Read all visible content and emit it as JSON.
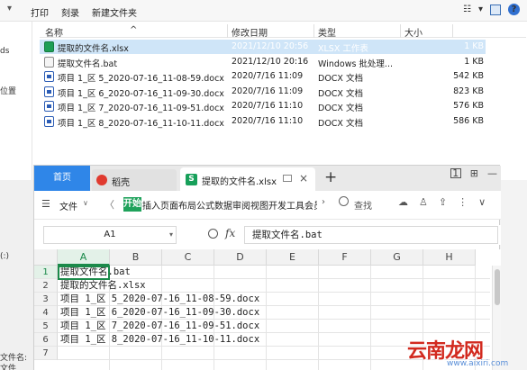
{
  "explorer": {
    "toolbar": {
      "print": "打印",
      "burn": "刻录",
      "new_folder": "新建文件夹"
    },
    "nav_fragments": [
      "ds",
      "位置",
      "(:)"
    ],
    "columns": {
      "name": "名称",
      "date": "修改日期",
      "type": "类型",
      "size": "大小"
    },
    "files": [
      {
        "name": "提取的文件名.xlsx",
        "date": "2021/12/10 20:56",
        "type": "XLSX 工作表",
        "size": "1 KB",
        "icon": "xlsx-icon",
        "selected": true
      },
      {
        "name": "提取文件名.bat",
        "date": "2021/12/10 20:16",
        "type": "Windows 批处理...",
        "size": "1 KB",
        "icon": "bat-icon",
        "selected": false
      },
      {
        "name": "项目 1_区 5_2020-07-16_11-08-59.docx",
        "date": "2020/7/16 11:09",
        "type": "DOCX 文档",
        "size": "542 KB",
        "icon": "docx-icon",
        "selected": false
      },
      {
        "name": "项目 1_区 6_2020-07-16_11-09-30.docx",
        "date": "2020/7/16 11:09",
        "type": "DOCX 文档",
        "size": "823 KB",
        "icon": "docx-icon",
        "selected": false
      },
      {
        "name": "项目 1_区 7_2020-07-16_11-09-51.docx",
        "date": "2020/7/16 11:10",
        "type": "DOCX 文档",
        "size": "576 KB",
        "icon": "docx-icon",
        "selected": false
      },
      {
        "name": "项目 1_区 8_2020-07-16_11-10-11.docx",
        "date": "2020/7/16 11:10",
        "type": "DOCX 文档",
        "size": "586 KB",
        "icon": "docx-icon",
        "selected": false
      }
    ],
    "bottom_fragment": "文件名:",
    "bottom_fragment2": "文件"
  },
  "wps": {
    "tabs": {
      "home": "首页",
      "daoke": "稻壳",
      "file": "提取的文件名.xlsx"
    },
    "ribbon": {
      "file_menu": "文件",
      "kai": "开始",
      "menus": "插入页面布局公式数据审阅视图开发工具会员专",
      "search": "查找"
    },
    "name_box": "A1",
    "formula": "提取文件名.bat",
    "columns": [
      "A",
      "B",
      "C",
      "D",
      "E",
      "F",
      "G",
      "H"
    ],
    "rows": [
      "1",
      "2",
      "3",
      "4",
      "5",
      "6",
      "7"
    ],
    "cells": [
      "提取文件名.bat",
      "提取的文件名.xlsx",
      "项目 1_区 5_2020-07-16_11-08-59.docx",
      "项目 1_区 6_2020-07-16_11-09-30.docx",
      "项目 1_区 7_2020-07-16_11-09-51.docx",
      "项目 1_区 8_2020-07-16_11-10-11.docx"
    ]
  },
  "watermark": {
    "main": "云南龙网",
    "sub": "www.aixiri.com"
  },
  "colors": {
    "accent_blue": "#2f86e8",
    "excel_green": "#1b8a4a",
    "selection": "#cfe5f8"
  }
}
